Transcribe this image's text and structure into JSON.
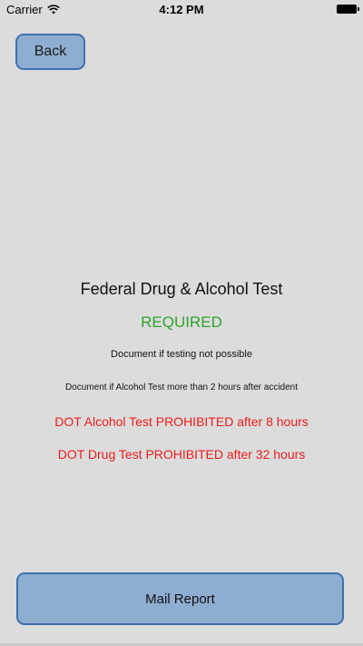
{
  "status_bar": {
    "carrier": "Carrier",
    "time": "4:12 PM",
    "wifi_icon": "wifi-icon",
    "battery_icon": "battery-icon"
  },
  "nav": {
    "back_label": "Back"
  },
  "main": {
    "title": "Federal Drug & Alcohol Test",
    "status": "REQUIRED",
    "notes": [
      "Document if testing not possible",
      "Document if Alcohol Test more than 2 hours after accident"
    ],
    "warnings": [
      "DOT Alcohol Test PROHIBITED after 8 hours",
      "DOT Drug Test PROHIBITED after 32 hours"
    ]
  },
  "footer": {
    "mail_report_label": "Mail Report"
  },
  "colors": {
    "background": "#dcdcdc",
    "button_fill": "#8eaed1",
    "button_border": "#3f6fb0",
    "required_green": "#2aa52a",
    "warning_red": "#ee1c1c"
  }
}
